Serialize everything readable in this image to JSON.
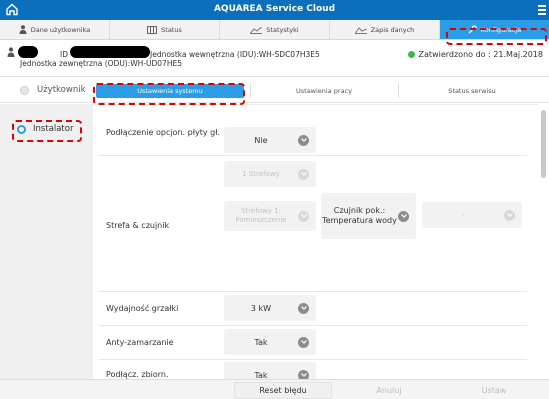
{
  "app": {
    "title": "AQUAREA Service Cloud",
    "home_icon": "home-icon",
    "menu_icon": "hamburger-icon"
  },
  "main_tabs": [
    {
      "label": "Dane użytkownika",
      "icon": "person-icon"
    },
    {
      "label": "Status",
      "icon": "panel-icon"
    },
    {
      "label": "Statystyki",
      "icon": "chart-icon"
    },
    {
      "label": "Zapis danych",
      "icon": "chart-icon"
    },
    {
      "label": "Konfiguracja",
      "icon": "wrench-icon"
    }
  ],
  "device": {
    "id_label": "ID",
    "indoor": "Jednostka wewnętrzna (IDU):WH-SDC07H3E5",
    "outdoor": "Jednostka zewnętrzna (ODU):WH-UD07HE5",
    "approved": "Zatwierdzono do : 21.Maj.2018"
  },
  "user_role": "Użytkownik",
  "sub_tabs": [
    "Ustawienia systemu",
    "Ustawienia pracy",
    "Status serwisu"
  ],
  "installer_role": "Instalator",
  "settings": {
    "optional_board": {
      "label": "Podłączenie opcjon. płyty gł.",
      "value": "Nie"
    },
    "zones": {
      "value": "1 Strefowy"
    },
    "zone_sensor": {
      "label": "Strefa & czujnik",
      "zone1": "Strefowy 1: Pomieszczenie",
      "sensor": "Czujnik pok.: Temperatura wody",
      "extra": "-"
    },
    "heater": {
      "label": "Wydajność grzałki",
      "value": "3 kW"
    },
    "antifreeze": {
      "label": "Anty-zamarzanie",
      "value": "Tak"
    },
    "tank": {
      "label": "Podłącz. zbiorn.",
      "value": "Tak"
    }
  },
  "buttons": {
    "reset": "Reset błędu",
    "cancel": "Anuluj",
    "set": "Ustaw"
  },
  "colors": {
    "topbar": "#0c6fbe",
    "active": "#2b9de6",
    "approved_dot": "#3cb94a",
    "highlight": "#e00000"
  }
}
